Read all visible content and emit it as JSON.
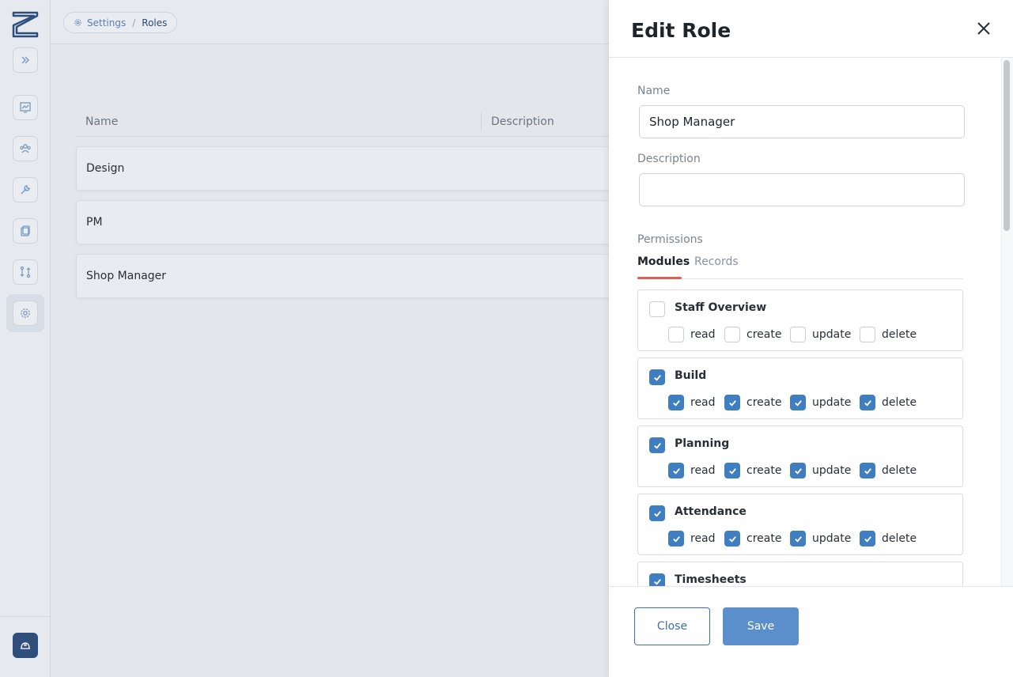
{
  "breadcrumb": {
    "settings": "Settings",
    "separator": "/",
    "current": "Roles"
  },
  "table": {
    "headers": {
      "name": "Name",
      "description": "Description"
    },
    "rows": [
      "Design",
      "PM",
      "Shop Manager"
    ]
  },
  "rail": {
    "items": [
      "expand-icon",
      "chart-icon",
      "team-icon",
      "wrench-icon",
      "clipboard-icon",
      "workflow-icon",
      "settings-icon"
    ],
    "account_icon": "hardhat-icon",
    "accent": "#2e4f7c"
  },
  "drawer": {
    "title": "Edit Role",
    "name_label": "Name",
    "name_value": "Shop Manager",
    "description_label": "Description",
    "description_value": "",
    "permissions_label": "Permissions",
    "tabs": {
      "modules": "Modules",
      "records": "Records"
    },
    "modules": [
      {
        "title": "Staff Overview",
        "checked": false,
        "perms": [
          {
            "label": "read",
            "checked": false
          },
          {
            "label": "create",
            "checked": false
          },
          {
            "label": "update",
            "checked": false
          },
          {
            "label": "delete",
            "checked": false
          }
        ]
      },
      {
        "title": "Build",
        "checked": true,
        "perms": [
          {
            "label": "read",
            "checked": true
          },
          {
            "label": "create",
            "checked": true
          },
          {
            "label": "update",
            "checked": true
          },
          {
            "label": "delete",
            "checked": true
          }
        ]
      },
      {
        "title": "Planning",
        "checked": true,
        "perms": [
          {
            "label": "read",
            "checked": true
          },
          {
            "label": "create",
            "checked": true
          },
          {
            "label": "update",
            "checked": true
          },
          {
            "label": "delete",
            "checked": true
          }
        ]
      },
      {
        "title": "Attendance",
        "checked": true,
        "perms": [
          {
            "label": "read",
            "checked": true
          },
          {
            "label": "create",
            "checked": true
          },
          {
            "label": "update",
            "checked": true
          },
          {
            "label": "delete",
            "checked": true
          }
        ]
      },
      {
        "title": "Timesheets",
        "checked": true,
        "perms": []
      }
    ],
    "buttons": {
      "close": "Close",
      "save": "Save"
    },
    "colors": {
      "accent": "#3f7fc1",
      "tab_underline": "#d9605a",
      "save": "#5a8fcb"
    }
  }
}
